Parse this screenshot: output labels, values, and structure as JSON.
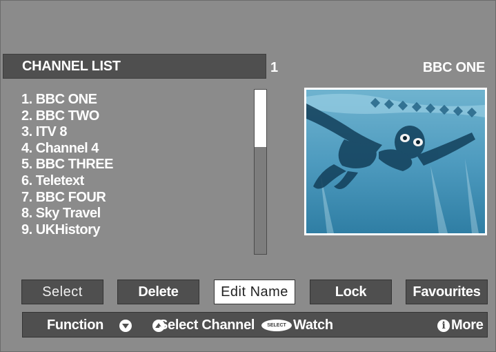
{
  "header": {
    "title": "CHANNEL LIST",
    "channel_number": "1",
    "channel_name": "BBC ONE"
  },
  "channels": [
    "1. BBC ONE",
    "2. BBC TWO",
    "3. ITV 8",
    "4. Channel 4",
    "5. BBC THREE",
    "6. Teletext",
    "7. BBC FOUR",
    "8. Sky Travel",
    "9. UKHistory"
  ],
  "scroll_position_fraction": 0.35,
  "buttons": {
    "select": "Select",
    "delete": "Delete",
    "edit_name": "Edit Name",
    "lock": "Lock",
    "favourites": "Favourites"
  },
  "footer": {
    "function": "Function",
    "select_channel": "Select Channel",
    "select_badge": "SELECT",
    "watch": "Watch",
    "more": "More",
    "info_glyph": "i"
  },
  "preview": {
    "icon": "swimmer-underwater-image"
  }
}
